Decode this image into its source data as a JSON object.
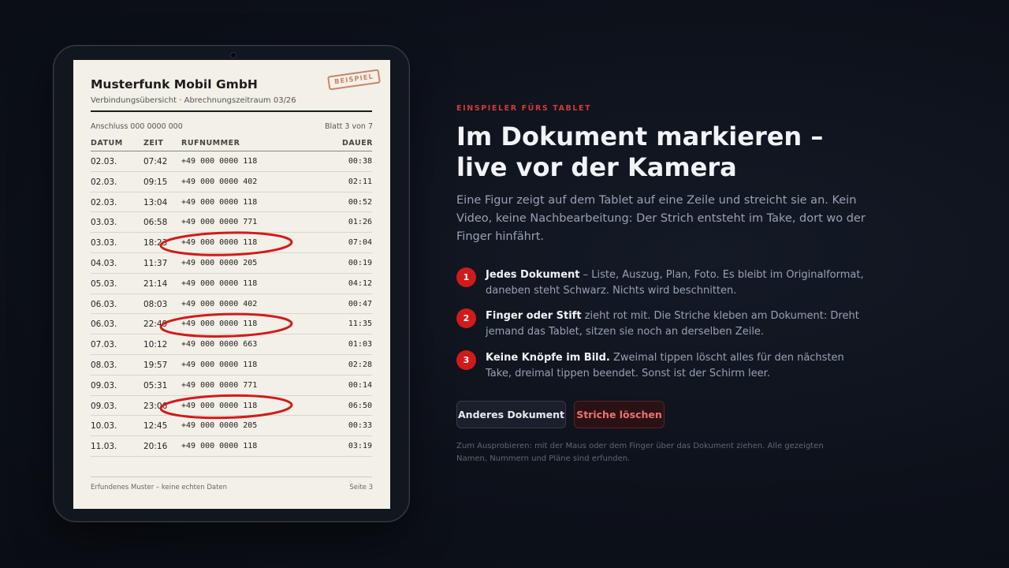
{
  "document": {
    "company": "Musterfunk Mobil GmbH",
    "subtitle": "Verbindungsübersicht · Abrechnungszeitraum 03/26",
    "stamp": "BEISPIEL",
    "account": "Anschluss 000 0000 000",
    "sheet": "Blatt 3 von 7",
    "columns": {
      "date": "DATUM",
      "time": "ZEIT",
      "number": "RUFNUMMER",
      "duration": "DAUER"
    },
    "rows": [
      {
        "date": "02.03.",
        "time": "07:42",
        "number": "+49 000 0000 118",
        "duration": "00:38",
        "circled": false
      },
      {
        "date": "02.03.",
        "time": "09:15",
        "number": "+49 000 0000 402",
        "duration": "02:11",
        "circled": false
      },
      {
        "date": "02.03.",
        "time": "13:04",
        "number": "+49 000 0000 118",
        "duration": "00:52",
        "circled": false
      },
      {
        "date": "03.03.",
        "time": "06:58",
        "number": "+49 000 0000 771",
        "duration": "01:26",
        "circled": false
      },
      {
        "date": "03.03.",
        "time": "18:23",
        "number": "+49 000 0000 118",
        "duration": "07:04",
        "circled": true
      },
      {
        "date": "04.03.",
        "time": "11:37",
        "number": "+49 000 0000 205",
        "duration": "00:19",
        "circled": false
      },
      {
        "date": "05.03.",
        "time": "21:14",
        "number": "+49 000 0000 118",
        "duration": "04:12",
        "circled": false
      },
      {
        "date": "06.03.",
        "time": "08:03",
        "number": "+49 000 0000 402",
        "duration": "00:47",
        "circled": false
      },
      {
        "date": "06.03.",
        "time": "22:49",
        "number": "+49 000 0000 118",
        "duration": "11:35",
        "circled": true
      },
      {
        "date": "07.03.",
        "time": "10:12",
        "number": "+49 000 0000 663",
        "duration": "01:03",
        "circled": false
      },
      {
        "date": "08.03.",
        "time": "19:57",
        "number": "+49 000 0000 118",
        "duration": "02:28",
        "circled": false
      },
      {
        "date": "09.03.",
        "time": "05:31",
        "number": "+49 000 0000 771",
        "duration": "00:14",
        "circled": false
      },
      {
        "date": "09.03.",
        "time": "23:06",
        "number": "+49 000 0000 118",
        "duration": "06:50",
        "circled": true
      },
      {
        "date": "10.03.",
        "time": "12:45",
        "number": "+49 000 0000 205",
        "duration": "00:33",
        "circled": false
      },
      {
        "date": "11.03.",
        "time": "20:16",
        "number": "+49 000 0000 118",
        "duration": "03:19",
        "circled": false
      }
    ],
    "footer": "Erfundenes Muster – keine echten Daten",
    "footer_page": "Seite 3",
    "mark_color": "#d11b1b"
  },
  "panel": {
    "eyebrow": "EINSPIELER FÜRS TABLET",
    "headline_line1": "Im Dokument markieren –",
    "headline_line2": "live vor der Kamera",
    "intro": "Eine Figur zeigt auf dem Tablet auf eine Zeile und streicht sie an. Kein Video, keine Nachbearbeitung: Der Strich entsteht im Take, dort wo der Finger hinfährt.",
    "steps": [
      {
        "num": "1",
        "bold": "Jedes Dokument",
        "text": " – Liste, Auszug, Plan, Foto. Es bleibt im Originalformat, daneben steht Schwarz. Nichts wird beschnitten."
      },
      {
        "num": "2",
        "bold": "Finger oder Stift",
        "text": " zieht rot mit. Die Striche kleben am Dokument: Dreht jemand das Tablet, sitzen sie noch an derselben Zeile."
      },
      {
        "num": "3",
        "bold": "Keine Knöpfe im Bild.",
        "text": " Zweimal tippen löscht alles für den nächsten Take, dreimal tippen beendet. Sonst ist der Schirm leer."
      }
    ],
    "btn_other": "Anderes Dokument",
    "btn_clear": "Striche löschen",
    "note": "Zum Ausprobieren: mit der Maus oder dem Finger über das Dokument ziehen. Alle gezeigten Namen, Nummern und Pläne sind erfunden.",
    "accent": "#d33a3a"
  }
}
